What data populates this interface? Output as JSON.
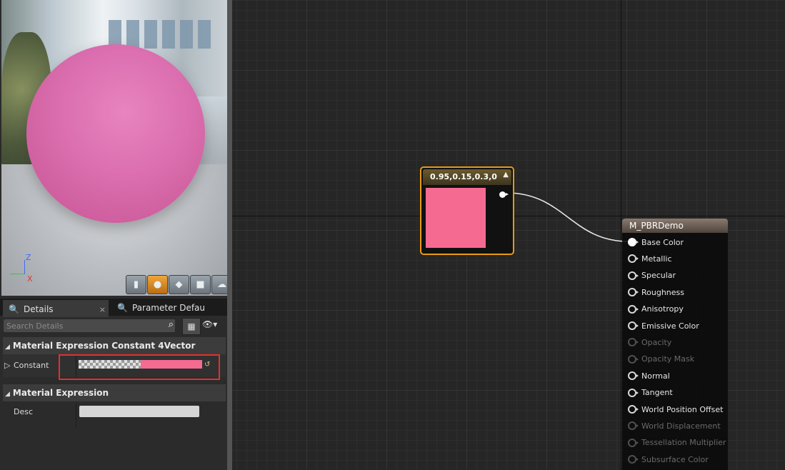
{
  "viewport": {
    "axis_labels": {
      "z": "Z",
      "x": "X"
    },
    "buttons": [
      {
        "name": "cylinder-preview-button",
        "icon": "▮"
      },
      {
        "name": "sphere-preview-button",
        "icon": "●"
      },
      {
        "name": "plane-preview-button",
        "icon": "◆"
      },
      {
        "name": "cube-preview-button",
        "icon": "■"
      },
      {
        "name": "teapot-preview-button",
        "icon": "☁"
      }
    ]
  },
  "details": {
    "tabs": [
      {
        "label": "Details",
        "icon": "🔍",
        "close": "×"
      },
      {
        "label": "Parameter Defaults",
        "icon": "🔍"
      }
    ],
    "search_placeholder": "Search Details",
    "view_options_icon": "▦",
    "eye_icon": "👁▾",
    "category_constant": "Material Expression Constant 4Vector",
    "constant_label": "Constant",
    "reset_icon": "↺",
    "category_expression": "Material Expression",
    "desc_label": "Desc",
    "desc_value": ""
  },
  "graph": {
    "constant_node": {
      "title": "0.95,0.15,0.3,0",
      "collapse_icon": "▲",
      "color": "#f56a91"
    },
    "result_node": {
      "title": "M_PBRDemo",
      "pins": [
        {
          "label": "Base Color",
          "state": "connected"
        },
        {
          "label": "Metallic",
          "state": "enabled"
        },
        {
          "label": "Specular",
          "state": "enabled"
        },
        {
          "label": "Roughness",
          "state": "enabled"
        },
        {
          "label": "Anisotropy",
          "state": "enabled"
        },
        {
          "label": "Emissive Color",
          "state": "enabled"
        },
        {
          "label": "Opacity",
          "state": "disabled"
        },
        {
          "label": "Opacity Mask",
          "state": "disabled"
        },
        {
          "label": "Normal",
          "state": "enabled"
        },
        {
          "label": "Tangent",
          "state": "enabled"
        },
        {
          "label": "World Position Offset",
          "state": "enabled"
        },
        {
          "label": "World Displacement",
          "state": "disabled"
        },
        {
          "label": "Tessellation Multiplier",
          "state": "disabled"
        },
        {
          "label": "Subsurface Color",
          "state": "disabled"
        }
      ]
    }
  }
}
